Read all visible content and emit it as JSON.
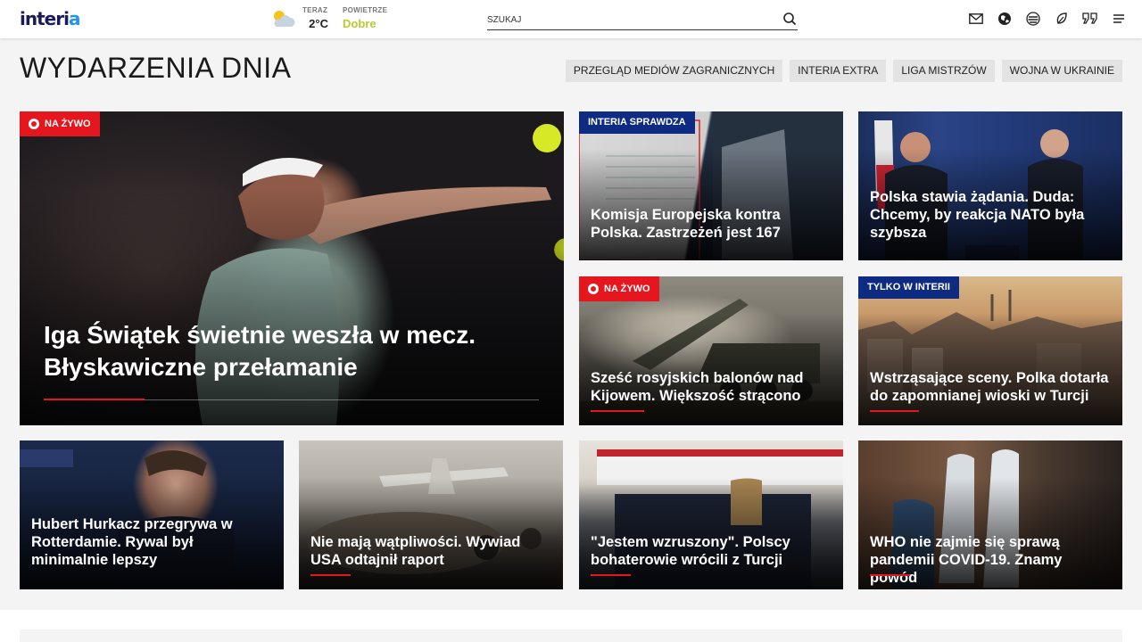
{
  "header": {
    "logo": {
      "text_main": "interi",
      "text_end": "a"
    },
    "weather": {
      "now_label": "TERAZ",
      "now_temp": "2°C",
      "air_label": "POWIETRZE",
      "air_value": "Dobre"
    },
    "search": {
      "placeholder": "SZUKAJ"
    },
    "icons": [
      "mail-icon",
      "globe-icon",
      "layers-icon",
      "leaf-icon",
      "quote-icon",
      "menu-icon"
    ]
  },
  "section": {
    "title": "WYDARZENIA DNIA",
    "tags": [
      "PRZEGLĄD MEDIÓW ZAGRANICZNYCH",
      "INTERIA EXTRA",
      "LIGA MISTRZÓW",
      "WOJNA W UKRAINIE"
    ]
  },
  "cards": {
    "main": {
      "badge": "NA ŻYWO",
      "title": "Iga Świątek świetnie weszła w mecz. Błyskawiczne przełamanie"
    },
    "c1": {
      "badge": "INTERIA SPRAWDZA",
      "title": "Komisja Europejska kontra Polska. Zastrzeżeń jest 167"
    },
    "c2": {
      "title": "Polska stawia żądania. Duda: Chcemy, by reakcja NATO była szybsza"
    },
    "c3": {
      "badge": "NA ŻYWO",
      "title": "Sześć rosyjskich balonów nad Kijowem. Większość strącono"
    },
    "c4": {
      "badge": "TYLKO W INTERII",
      "title": "Wstrząsające sceny. Polka dotarła do zapomnianej wioski w Turcji"
    },
    "c5": {
      "title": "Hubert Hurkacz przegrywa w Rotterdamie. Rywal był minimalnie lepszy"
    },
    "c6": {
      "title": "Nie mają wątpliwości. Wywiad USA odtajnił raport"
    },
    "c7": {
      "title": "\"Jestem wzruszony\". Polscy bohaterowie wrócili z Turcji"
    },
    "c8": {
      "title": "WHO nie zajmie się sprawą pandemii COVID-19. Znamy powód"
    }
  },
  "colors": {
    "accent_red": "#e5161e",
    "badge_blue": "#0d2b82",
    "air_good": "#b8cc2f"
  }
}
